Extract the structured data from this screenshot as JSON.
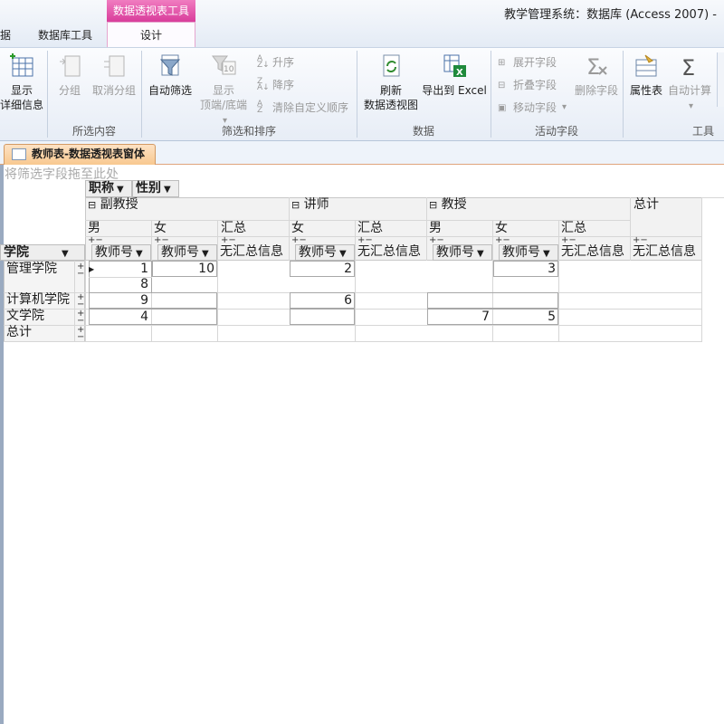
{
  "titlebar": {
    "context_label": "数据透视表工具",
    "app_title": "教学管理系统：数据库 (Access 2007) -",
    "tabs": [
      "据",
      "数据库工具",
      "设计"
    ]
  },
  "ribbon": {
    "groups": {
      "g1": "所选内容",
      "g2": "筛选和排序",
      "g3": "数据",
      "g4": "活动字段",
      "g5": "工具"
    },
    "buttons": {
      "show_details": "显示",
      "show_details_2": "详细信息",
      "group": "分组",
      "ungroup": "取消分组",
      "auto_filter": "自动筛选",
      "show_top": "显示",
      "top_bottom": "顶端/底端",
      "sort_asc": "升序",
      "sort_desc": "降序",
      "clear_custom_order": "清除自定义顺序",
      "refresh": "刷新",
      "refresh_2": "数据透视图",
      "export_excel": "导出到 Excel",
      "expand_field": "展开字段",
      "collapse_field": "折叠字段",
      "move_field": "移动字段",
      "delete_field": "删除字段",
      "property_sheet": "属性表",
      "auto_calc": "自动计算"
    }
  },
  "document_tab": {
    "title": "教师表-数据透视表窗体"
  },
  "pivot": {
    "filter_zone": "将筛选字段拖至此处",
    "column_fields": [
      "职称",
      "性别"
    ],
    "row_field": "学院",
    "titles": [
      "副教授",
      "讲师",
      "教授"
    ],
    "grand_total_col": "总计",
    "gender_headers": {
      "assoc_prof": [
        "男",
        "女",
        "汇总"
      ],
      "lecturer": [
        "女",
        "汇总"
      ],
      "professor": [
        "男",
        "女",
        "汇总"
      ]
    },
    "measure": "教师号",
    "no_summary": "无汇总信息",
    "rows": [
      "管理学院",
      "计算机学院",
      "文学院",
      "总计"
    ],
    "values": {
      "mgmt_ap_male": [
        "1",
        "8"
      ],
      "mgmt_ap_female": "10",
      "mgmt_lec_female": "2",
      "mgmt_prof_female": "3",
      "cs_ap_male": "9",
      "cs_lec_female": "6",
      "lit_ap_male": "4",
      "lit_prof_male": "7",
      "lit_prof_female": "5"
    }
  }
}
